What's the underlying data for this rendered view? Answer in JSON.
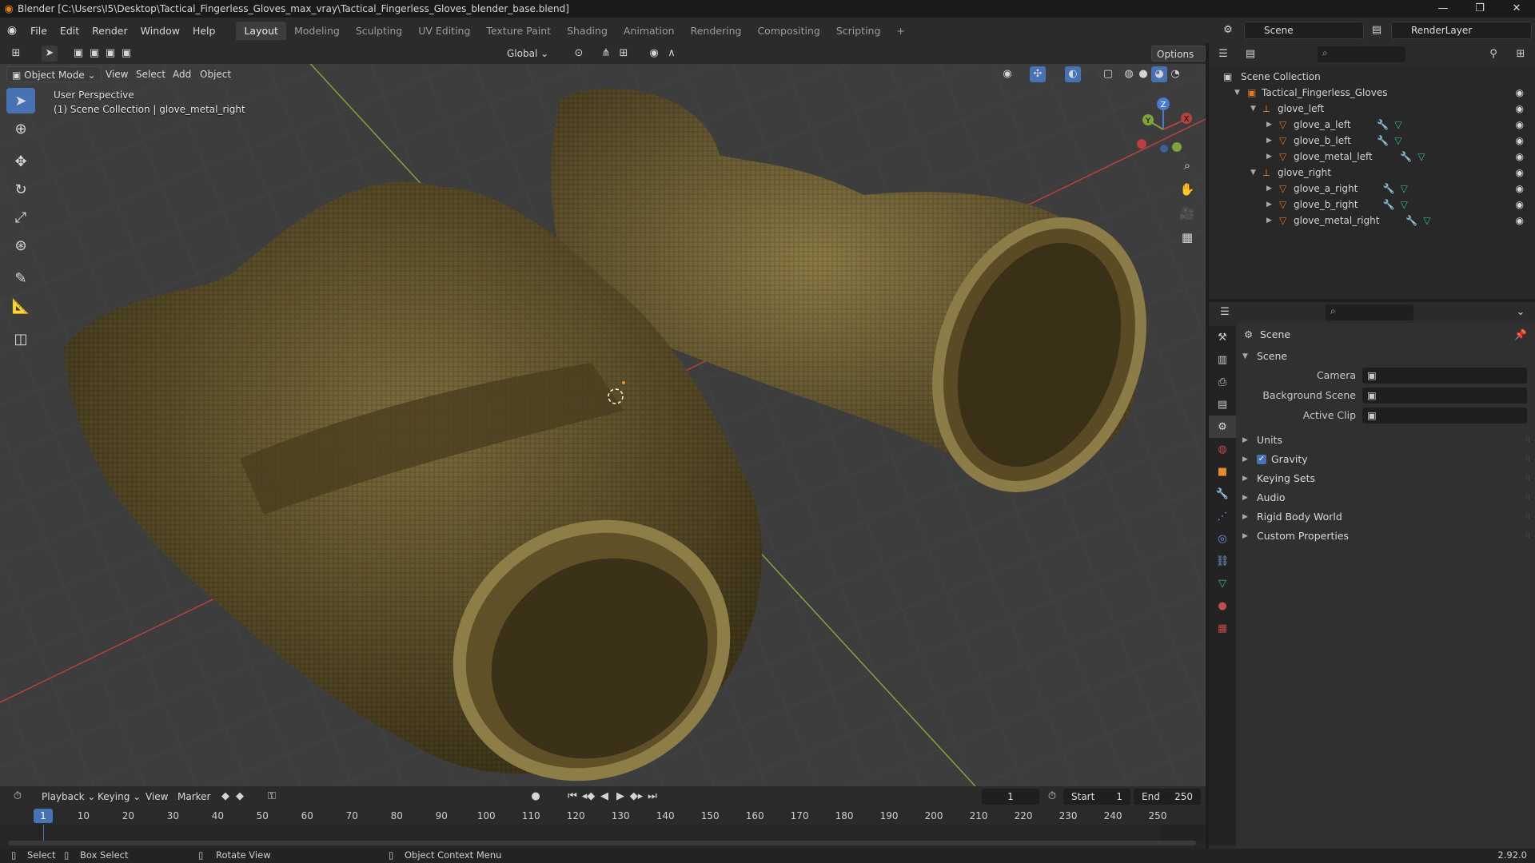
{
  "window": {
    "title": "Blender [C:\\Users\\I5\\Desktop\\Tactical_Fingerless_Gloves_max_vray\\Tactical_Fingerless_Gloves_blender_base.blend]",
    "controls": [
      "—",
      "❐",
      "✕"
    ]
  },
  "menubar": {
    "items": [
      "File",
      "Edit",
      "Render",
      "Window",
      "Help"
    ],
    "workspaces": [
      "Layout",
      "Modeling",
      "Sculpting",
      "UV Editing",
      "Texture Paint",
      "Shading",
      "Animation",
      "Rendering",
      "Compositing",
      "Scripting"
    ],
    "active_workspace": "Layout",
    "add_tab": "+",
    "scene_name": "Scene",
    "view_layer": "RenderLayer"
  },
  "viewport_header": {
    "mode": "Object Mode",
    "menus": [
      "View",
      "Select",
      "Add",
      "Object"
    ],
    "orientation": "Global",
    "options": "Options"
  },
  "viewport": {
    "perspective": "User Perspective",
    "collection_info": "(1) Scene Collection | glove_metal_right",
    "gizmo": {
      "x": "X",
      "y": "Y",
      "z": "Z"
    }
  },
  "outliner": {
    "root": "Scene Collection",
    "items": [
      {
        "label": "Tactical_Fingerless_Gloves",
        "type": "collection",
        "depth": 1,
        "expanded": true,
        "mods": false
      },
      {
        "label": "glove_left",
        "type": "empty",
        "depth": 2,
        "expanded": true,
        "mods": false
      },
      {
        "label": "glove_a_left",
        "type": "mesh",
        "depth": 3,
        "expanded": false,
        "mods": true
      },
      {
        "label": "glove_b_left",
        "type": "mesh",
        "depth": 3,
        "expanded": false,
        "mods": true
      },
      {
        "label": "glove_metal_left",
        "type": "mesh",
        "depth": 3,
        "expanded": false,
        "mods": true
      },
      {
        "label": "glove_right",
        "type": "empty",
        "depth": 2,
        "expanded": true,
        "mods": false
      },
      {
        "label": "glove_a_right",
        "type": "mesh",
        "depth": 3,
        "expanded": false,
        "mods": true
      },
      {
        "label": "glove_b_right",
        "type": "mesh",
        "depth": 3,
        "expanded": false,
        "mods": true
      },
      {
        "label": "glove_metal_right",
        "type": "mesh",
        "depth": 3,
        "expanded": false,
        "mods": true
      }
    ]
  },
  "properties": {
    "context": "Scene",
    "panel": "Scene",
    "fields": [
      {
        "label": "Camera",
        "value": ""
      },
      {
        "label": "Background Scene",
        "value": ""
      },
      {
        "label": "Active Clip",
        "value": ""
      }
    ],
    "sections": [
      {
        "label": "Units",
        "checkbox": false
      },
      {
        "label": "Gravity",
        "checkbox": true
      },
      {
        "label": "Keying Sets",
        "checkbox": false
      },
      {
        "label": "Audio",
        "checkbox": false
      },
      {
        "label": "Rigid Body World",
        "checkbox": false
      },
      {
        "label": "Custom Properties",
        "checkbox": false
      }
    ]
  },
  "timeline": {
    "menus": [
      "Playback",
      "Keying",
      "View",
      "Marker"
    ],
    "current_frame": "1",
    "start_label": "Start",
    "start": "1",
    "end_label": "End",
    "end": "250",
    "ticks": [
      "10",
      "20",
      "30",
      "40",
      "50",
      "60",
      "70",
      "80",
      "90",
      "100",
      "110",
      "120",
      "130",
      "140",
      "150",
      "160",
      "170",
      "180",
      "190",
      "200",
      "210",
      "220",
      "230",
      "240",
      "250"
    ]
  },
  "statusbar": {
    "select": "Select",
    "box_select": "Box Select",
    "rotate_view": "Rotate View",
    "context_menu": "Object Context Menu",
    "version": "2.92.0"
  },
  "colors": {
    "accent": "#4772b3",
    "axis_x": "#b8403f",
    "axis_y": "#7ea43c",
    "glove": "#7a6a3a"
  }
}
